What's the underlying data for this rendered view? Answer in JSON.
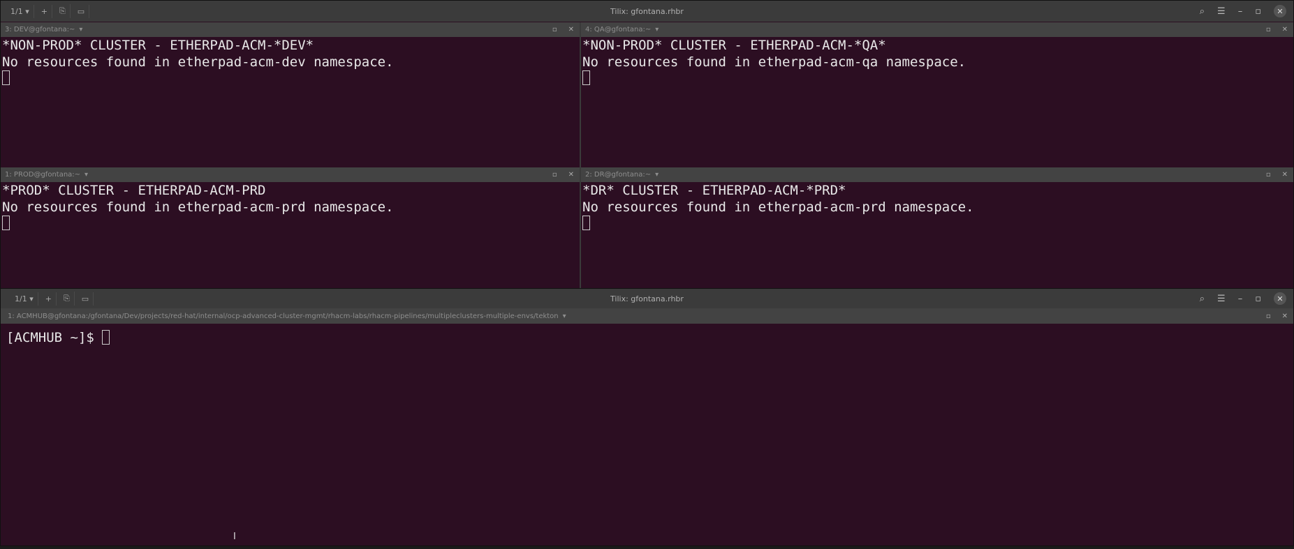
{
  "top_window": {
    "title": "Tilix: gfontana.rhbr",
    "session_label": "1/1 ▾",
    "panes": [
      {
        "title": "3: DEV@gfontana:~",
        "lines": [
          "*NON-PROD* CLUSTER - ETHERPAD-ACM-*DEV*",
          "No resources found in etherpad-acm-dev namespace."
        ]
      },
      {
        "title": "4: QA@gfontana:~",
        "lines": [
          "*NON-PROD* CLUSTER - ETHERPAD-ACM-*QA*",
          "No resources found in etherpad-acm-qa namespace."
        ]
      },
      {
        "title": "1: PROD@gfontana:~",
        "lines": [
          "*PROD* CLUSTER - ETHERPAD-ACM-PRD",
          "No resources found in etherpad-acm-prd namespace."
        ]
      },
      {
        "title": "2: DR@gfontana:~",
        "lines": [
          "*DR* CLUSTER - ETHERPAD-ACM-*PRD*",
          "No resources found in etherpad-acm-prd namespace."
        ]
      }
    ]
  },
  "bottom_window": {
    "title": "Tilix: gfontana.rhbr",
    "session_label": "1/1 ▾",
    "pane_title": "1: ACMHUB@gfontana:/gfontana/Dev/projects/red-hat/internal/ocp-advanced-cluster-mgmt/rhacm-labs/rhacm-pipelines/multipleclusters-multiple-envs/tekton",
    "prompt": "[ACMHUB ~]$ "
  }
}
